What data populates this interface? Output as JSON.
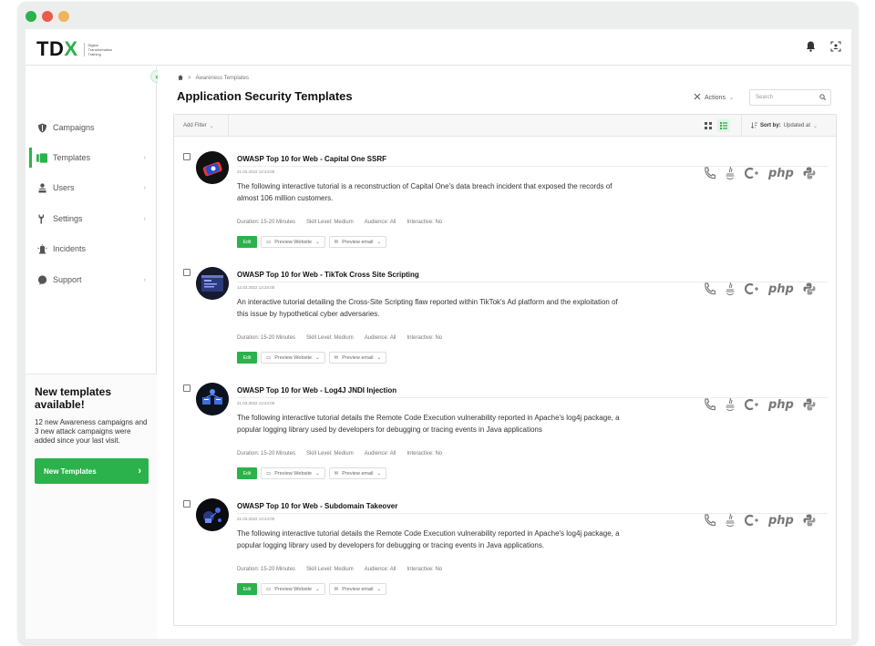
{
  "window": {
    "dots": [
      "#2bb24c",
      "#e85d4a",
      "#f0b45a"
    ]
  },
  "brand": {
    "logo_main": "TD",
    "logo_x": "X",
    "logo_sub": "Digital Transformation Training",
    "accent": "#2bb24c"
  },
  "topbar": {
    "icons": [
      "bell-icon",
      "user-scan-icon"
    ]
  },
  "sidebar": {
    "items": [
      {
        "label": "Campaigns",
        "icon": "shield-icon",
        "chevron": ""
      },
      {
        "label": "Templates",
        "icon": "templates-icon",
        "chevron": "›"
      },
      {
        "label": "Users",
        "icon": "users-icon",
        "chevron": "›"
      },
      {
        "label": "Settings",
        "icon": "wrench-icon",
        "chevron": "›"
      },
      {
        "label": "Incidents",
        "icon": "alert-icon",
        "chevron": ""
      },
      {
        "label": "Support",
        "icon": "chat-icon",
        "chevron": "›"
      }
    ],
    "promo": {
      "title": "New templates available!",
      "text": "12 new Awareness campaigns and 3 new attack campaigns were added since your last visit.",
      "button": "New Templates"
    }
  },
  "main": {
    "breadcrumb": ">",
    "breadcrumb_item": "Awareness Templates",
    "title": "Application Security Templates",
    "actions_label": "Actions",
    "search_placeholder": "Search",
    "add_filter": "Add Filter",
    "sort_label": "Sort by:",
    "sort_value": "Updated at"
  },
  "templates": [
    {
      "title": "OWASP Top 10 for Web - Capital One SSRF",
      "date": "21.03.2022 13:24:00",
      "description": "The following interactive tutorial is a reconstruction of Capital One's data breach incident that exposed the records of almost 106 million customers.",
      "duration": "Duration: 15-20 Minutes",
      "skill": "Skill Level: Medium",
      "audience": "Audience: All",
      "interactive": "Interactive: No",
      "edit": "Edit",
      "preview_website": "Preview Website",
      "preview_email": "Preview email",
      "languages": [
        "phone-icon",
        "java-icon",
        "cplusplus-icon",
        "php",
        "python-icon"
      ]
    },
    {
      "title": "OWASP Top 10 for Web - TikTok Cross Site Scripting",
      "date": "12.03.2022 13:24:00",
      "description": "An interactive tutorial detailing the Cross-Site Scripting flaw reported within TikTok's Ad platform and the exploitation of this issue by hypothetical cyber adversaries.",
      "duration": "Duration: 15-20 Minutes",
      "skill": "Skill Level: Medium",
      "audience": "Audience: All",
      "interactive": "Interactive: No",
      "edit": "Edit",
      "preview_website": "Preview Website",
      "preview_email": "Preview email",
      "languages": [
        "phone-icon",
        "java-icon",
        "cplusplus-icon",
        "php",
        "python-icon"
      ]
    },
    {
      "title": "OWASP Top 10 for Web - Log4J JNDI Injection",
      "date": "21.03.2022 13:24:00",
      "description": "The following interactive tutorial details the Remote Code Execution vulnerability reported in Apache's log4j package, a popular logging library used by developers for debugging or tracing events in Java applications",
      "duration": "Duration: 15-20 Minutes",
      "skill": "Skill Level: Medium",
      "audience": "Audience: All",
      "interactive": "Interactive: No",
      "edit": "Edit",
      "preview_website": "Preview Website",
      "preview_email": "Preview email",
      "languages": [
        "phone-icon",
        "java-icon",
        "cplusplus-icon",
        "php",
        "python-icon"
      ]
    },
    {
      "title": "OWASP Top 10 for Web - Subdomain Takeover",
      "date": "21.03.2022 13:24:00",
      "description": "The following interactive tutorial details the Remote Code Execution vulnerability reported in Apache's log4j package, a popular logging library used by developers for debugging or tracing events in Java applications.",
      "duration": "Duration: 15-20 Minutes",
      "skill": "Skill Level: Medium",
      "audience": "Audience: All",
      "interactive": "Interactive: No",
      "edit": "Edit",
      "preview_website": "Preview Website",
      "preview_email": "Preview email",
      "languages": [
        "phone-icon",
        "java-icon",
        "cplusplus-icon",
        "php",
        "python-icon"
      ]
    }
  ]
}
